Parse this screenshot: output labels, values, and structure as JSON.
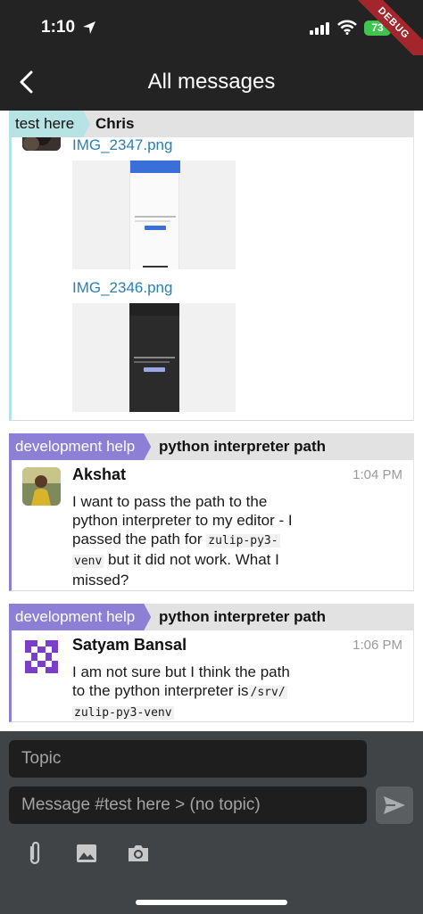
{
  "status_bar": {
    "time": "1:10",
    "battery": "73",
    "debug_label": "DEBUG"
  },
  "header": {
    "title": "All messages"
  },
  "recipients": [
    {
      "stream": "test here",
      "topic": "Chris",
      "stream_color": "#b8e3e4",
      "stream_text_color": "#111111"
    },
    {
      "stream": "development help",
      "topic": "python interpreter path",
      "stream_color": "#8e7fd6",
      "stream_text_color": "#ffffff"
    },
    {
      "stream": "development help",
      "topic": "python interpreter path",
      "stream_color": "#8e7fd6",
      "stream_text_color": "#ffffff"
    }
  ],
  "messages": {
    "chris": {
      "images": [
        {
          "filename": "IMG_2347.png",
          "theme": "light",
          "screen_title": "Choose account",
          "field_text": "Move profile image here"
        },
        {
          "filename": "IMG_2346.png",
          "theme": "dark",
          "screen_title": "Choose account",
          "field_text": "Move profile image here"
        }
      ]
    },
    "akshat": {
      "sender": "Akshat",
      "time": "1:04 PM",
      "line1": "I want to pass the path to the",
      "line2": "python interpreter to my editor - I",
      "line3": "passed the path for",
      "code1": "zulip-py3-",
      "code2": "venv",
      "line4_rest": " but it did not work. What I",
      "line5": "missed?"
    },
    "satyam": {
      "sender": "Satyam Bansal",
      "time": "1:06 PM",
      "line1": "I am not sure but I think the path",
      "line2": "to the python interpreter is",
      "code1": "/srv/",
      "code2": "zulip-py3-venv"
    }
  },
  "compose": {
    "topic_placeholder": "Topic",
    "message_placeholder": "Message #test here > (no topic)"
  },
  "icons": {
    "back": "back-arrow-icon",
    "send": "send-icon",
    "attach": "paperclip-icon",
    "image": "image-icon",
    "camera": "camera-icon"
  }
}
